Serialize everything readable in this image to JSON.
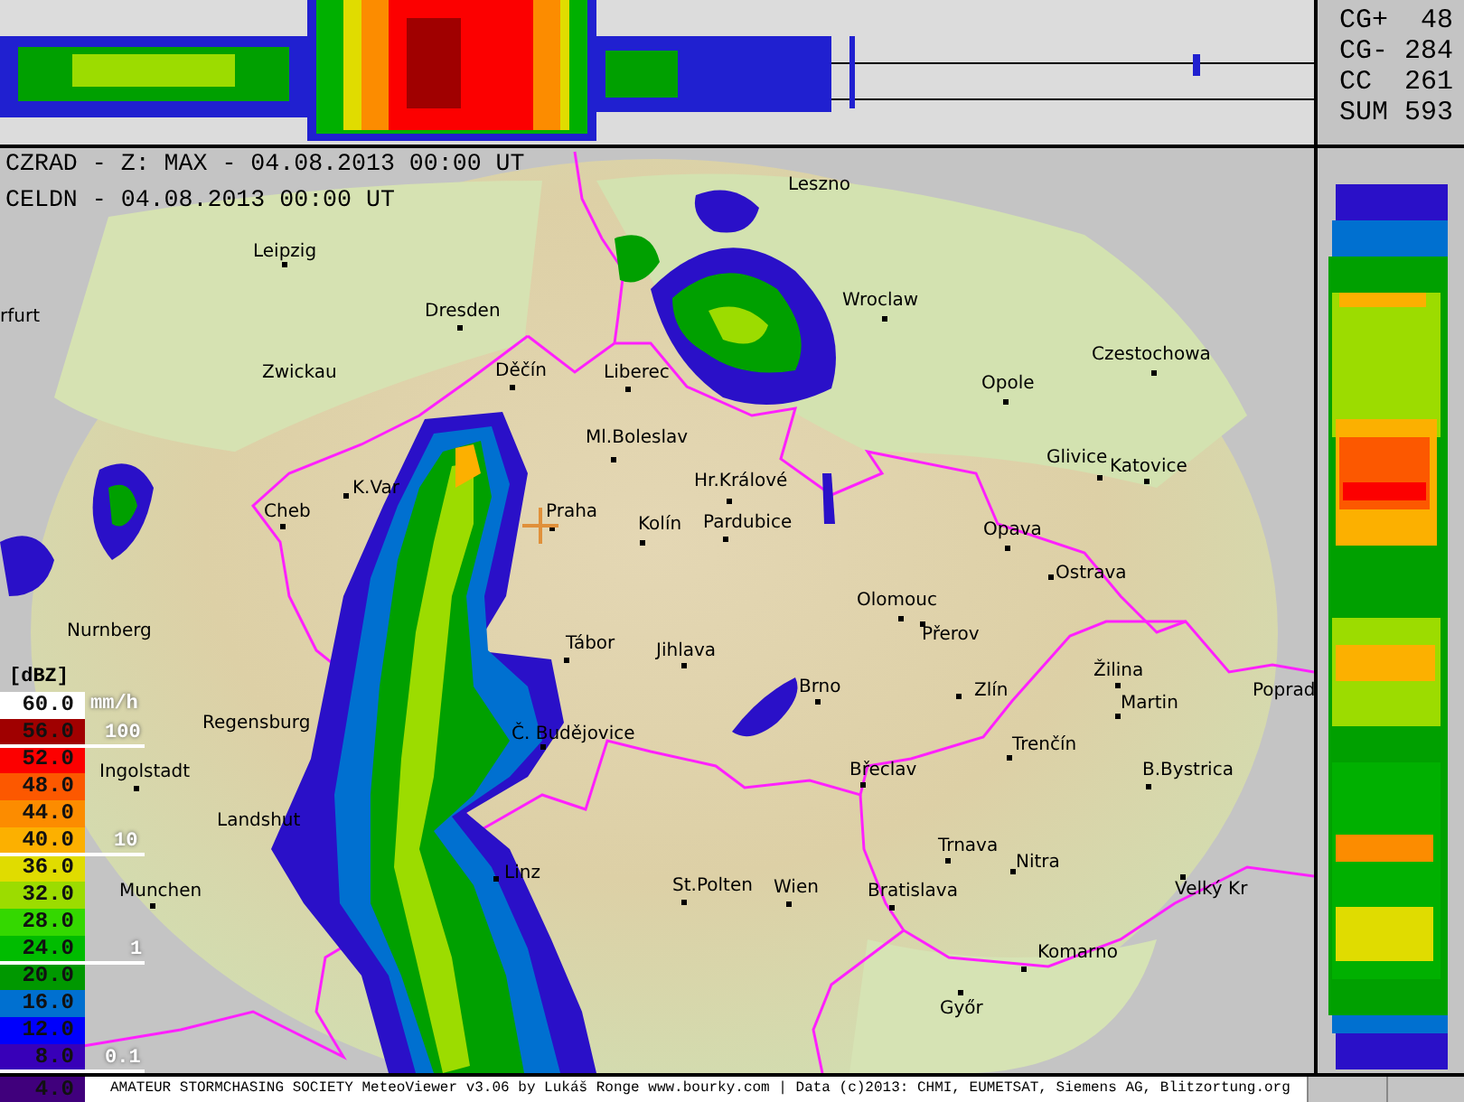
{
  "lightning_stats": [
    {
      "label": "CG+",
      "value": "48"
    },
    {
      "label": "CG-",
      "value": "284"
    },
    {
      "label": "CC",
      "value": "261"
    },
    {
      "label": "SUM",
      "value": "593"
    }
  ],
  "map_header": [
    "CZRAD - Z: MAX - 04.08.2013 00:00 UT",
    "CELDN - 04.08.2013 00:00 UT"
  ],
  "cities": [
    {
      "name": "Leszno"
    },
    {
      "name": "Leipzig"
    },
    {
      "name": "rfurt"
    },
    {
      "name": "Dresden"
    },
    {
      "name": "Wroclaw"
    },
    {
      "name": "Czestochowa"
    },
    {
      "name": "Zwickau"
    },
    {
      "name": "Opole"
    },
    {
      "name": "Děčín"
    },
    {
      "name": "Liberec"
    },
    {
      "name": "Ml.Boleslav"
    },
    {
      "name": "Glivice"
    },
    {
      "name": "Katovice"
    },
    {
      "name": "Hr.Králové"
    },
    {
      "name": "K.Var"
    },
    {
      "name": "Cheb"
    },
    {
      "name": "Praha"
    },
    {
      "name": "Kolín"
    },
    {
      "name": "Pardubice"
    },
    {
      "name": "Opava"
    },
    {
      "name": "Ostrava"
    },
    {
      "name": "Olomouc"
    },
    {
      "name": "Nurnberg"
    },
    {
      "name": "Přerov"
    },
    {
      "name": "Tábor"
    },
    {
      "name": "Jihlava"
    },
    {
      "name": "Žilina"
    },
    {
      "name": "Brno"
    },
    {
      "name": "Zlín"
    },
    {
      "name": "Martin"
    },
    {
      "name": "Poprad"
    },
    {
      "name": "Regensburg"
    },
    {
      "name": "Č. Budějovice"
    },
    {
      "name": "Trenčín"
    },
    {
      "name": "Ingolstadt"
    },
    {
      "name": "Břeclav"
    },
    {
      "name": "B.Bystrica"
    },
    {
      "name": "Landshut"
    },
    {
      "name": "Trnava"
    },
    {
      "name": "Nitra"
    },
    {
      "name": "Linz"
    },
    {
      "name": "Munchen"
    },
    {
      "name": "St.Polten"
    },
    {
      "name": "Wien"
    },
    {
      "name": "Bratislava"
    },
    {
      "name": "Velký Kr"
    },
    {
      "name": "Komarno"
    },
    {
      "name": "Győr"
    }
  ],
  "legend": {
    "unit": "[dBZ]",
    "items": [
      {
        "value": "60.0",
        "color": "#ffffff"
      },
      {
        "value": "56.0",
        "color": "#a00000"
      },
      {
        "value": "52.0",
        "color": "#fc0000"
      },
      {
        "value": "48.0",
        "color": "#fc5800"
      },
      {
        "value": "44.0",
        "color": "#fc8c00"
      },
      {
        "value": "40.0",
        "color": "#fcb000"
      },
      {
        "value": "36.0",
        "color": "#e0dc00"
      },
      {
        "value": "32.0",
        "color": "#9cdc00"
      },
      {
        "value": "28.0",
        "color": "#34d800"
      },
      {
        "value": "24.0",
        "color": "#00bc00"
      },
      {
        "value": "20.0",
        "color": "#009800"
      },
      {
        "value": "16.0",
        "color": "#0070d0"
      },
      {
        "value": "12.0",
        "color": "#0000fc"
      },
      {
        "value": "8.0",
        "color": "#3800b8"
      },
      {
        "value": "4.0",
        "color": "#40007c"
      }
    ]
  },
  "rain_scale": {
    "unit": "mm/h",
    "ticks": [
      "100",
      "10",
      "1",
      "0.1"
    ]
  },
  "credit": "AMATEUR STORMCHASING SOCIETY MeteoViewer v3.06 by Lukáš Ronge www.bourky.com | Data (c)2013: CHMI, EUMETSAT, Siemens AG, Blitzortung.org"
}
